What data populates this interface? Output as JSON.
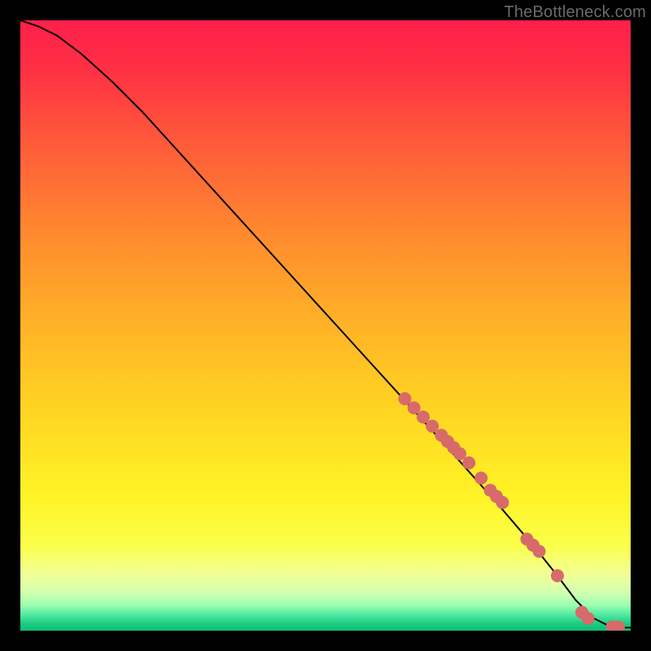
{
  "watermark": "TheBottleneck.com",
  "chart_data": {
    "type": "line",
    "title": "",
    "xlabel": "",
    "ylabel": "",
    "xlim": [
      0,
      100
    ],
    "ylim": [
      0,
      100
    ],
    "grid": false,
    "legend": false,
    "series": [
      {
        "name": "curve",
        "style": "line",
        "color": "#000000",
        "x": [
          0,
          3,
          6,
          10,
          15,
          20,
          30,
          40,
          50,
          60,
          70,
          78,
          84,
          88,
          91,
          94,
          97,
          100
        ],
        "y": [
          100,
          99,
          97.5,
          94.5,
          90,
          85,
          74,
          63,
          52,
          41,
          30,
          21,
          14,
          9,
          5,
          2,
          0.5,
          0.5
        ]
      },
      {
        "name": "markers",
        "style": "scatter",
        "color": "#d76a6a",
        "x": [
          63,
          64.5,
          66,
          67.5,
          69,
          70,
          71,
          72,
          73.5,
          75.5,
          77,
          78,
          79,
          83,
          84,
          85,
          88,
          92,
          93,
          97,
          98
        ],
        "y": [
          38,
          36.5,
          35,
          33.5,
          32,
          31,
          30,
          29,
          27.5,
          25,
          23,
          22,
          21,
          15,
          14,
          13,
          9,
          3,
          2,
          0.6,
          0.6
        ]
      }
    ],
    "gradient_stops": [
      {
        "offset": 0.0,
        "color": "#ff1f4b"
      },
      {
        "offset": 0.08,
        "color": "#ff3044"
      },
      {
        "offset": 0.2,
        "color": "#ff5a3a"
      },
      {
        "offset": 0.35,
        "color": "#ff8a2f"
      },
      {
        "offset": 0.5,
        "color": "#ffb327"
      },
      {
        "offset": 0.65,
        "color": "#ffd722"
      },
      {
        "offset": 0.78,
        "color": "#fff327"
      },
      {
        "offset": 0.86,
        "color": "#fbff4a"
      },
      {
        "offset": 0.905,
        "color": "#f2ff92"
      },
      {
        "offset": 0.935,
        "color": "#d7ffb0"
      },
      {
        "offset": 0.958,
        "color": "#9effb0"
      },
      {
        "offset": 0.975,
        "color": "#4be6a1"
      },
      {
        "offset": 0.99,
        "color": "#18c97f"
      },
      {
        "offset": 1.0,
        "color": "#0fbf77"
      }
    ]
  }
}
